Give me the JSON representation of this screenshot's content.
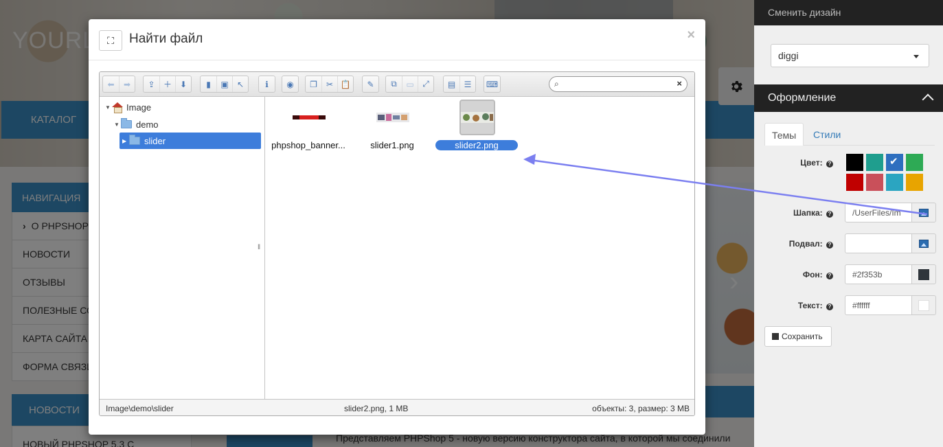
{
  "site": {
    "logo": "YOURL",
    "catalog": "КАТАЛОГ",
    "nav_head": "НАВИГАЦИЯ",
    "nav_items": [
      "О PHPSHOP",
      "НОВОСТИ",
      "ОТЗЫВЫ",
      "ПОЛЕЗНЫЕ СО",
      "КАРТА САЙТА",
      "ФОРМА СВЯЗИ"
    ],
    "news_head": "НОВОСТИ",
    "news_item": "НОВЫЙ PHPSHOP 5.3 С",
    "body_text": "Представляем PHPShop 5 - новую версию конструктора сайта, в которой мы соединили",
    "slider_next": "›"
  },
  "panel": {
    "top_title": "Сменить дизайн",
    "design_value": "diggi",
    "decor_title": "Оформление",
    "tabs": [
      "Темы",
      "Стили"
    ],
    "color_label": "Цвет:",
    "swatches": [
      "#000000",
      "#1f9e8e",
      "#2e6fbf",
      "#2eaa55",
      "#c00000",
      "#c9505a",
      "#2ba5c1",
      "#e8a400"
    ],
    "header_label": "Шапка:",
    "header_value": "/UserFiles/Im",
    "footer_label": "Подвал:",
    "footer_value": "",
    "bg_label": "Фон:",
    "bg_value": "#2f353b",
    "bg_color": "#2f353b",
    "text_label": "Текст:",
    "text_value": "#ffffff",
    "text_color": "#ffffff",
    "save_label": "Сохранить",
    "help_glyph": "?"
  },
  "modal": {
    "title": "Найти файл",
    "close": "×",
    "expand_glyph": "⛶",
    "tree": [
      {
        "label": "Image"
      },
      {
        "label": "demo"
      },
      {
        "label": "slider"
      }
    ],
    "files": [
      {
        "name": "phpshop_banner..."
      },
      {
        "name": "slider1.png"
      },
      {
        "name": "slider2.png"
      }
    ],
    "status": {
      "path": "Image\\demo\\slider",
      "selection": "slider2.png, 1 MB",
      "info": "объекты: 3, размер: 3 MB"
    }
  }
}
